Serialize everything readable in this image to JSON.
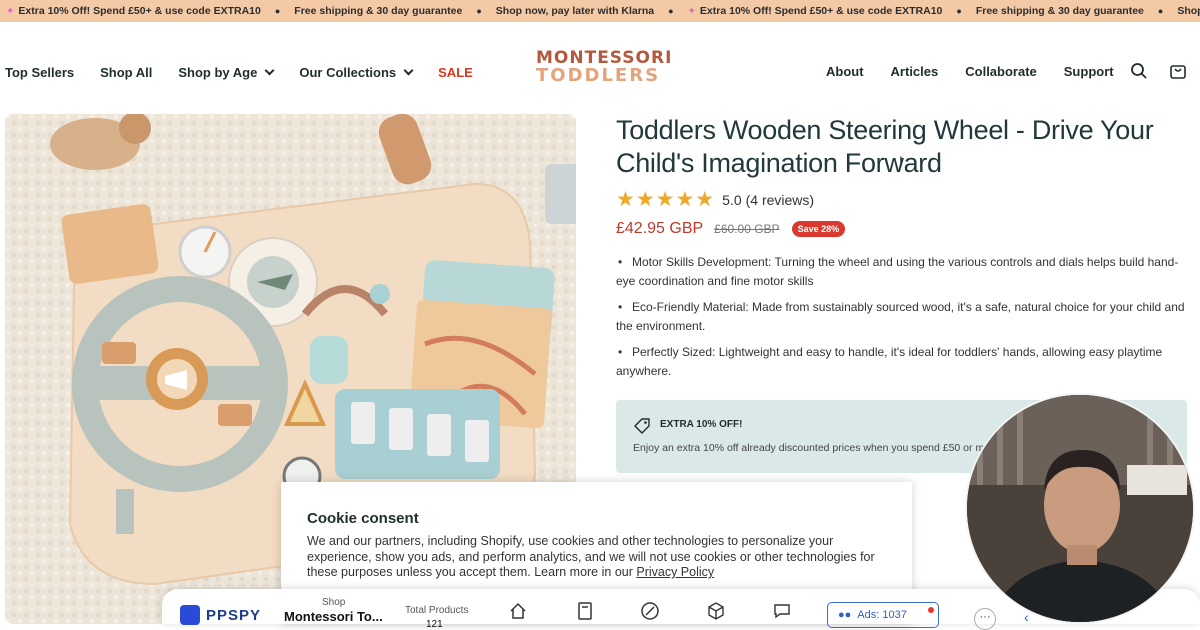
{
  "announcement": {
    "items": [
      {
        "icon": "sparkle-icon",
        "text": "Extra 10% Off! Spend £50+ & use code EXTRA10"
      },
      {
        "icon": "",
        "text": "Free shipping & 30 day guarantee"
      },
      {
        "icon": "",
        "text": "Shop now, pay later with Klarna"
      },
      {
        "icon": "sparkle-icon",
        "text": "Extra 10% Off! Spend £50+ & use code EXTRA10"
      },
      {
        "icon": "",
        "text": "Free shipping & 30 day guarantee"
      },
      {
        "icon": "",
        "text": "Shop now, pay later with Klarna"
      }
    ]
  },
  "nav": {
    "top_sellers": "Top Sellers",
    "shop_all": "Shop All",
    "shop_by_age": "Shop by Age",
    "our_collections": "Our Collections",
    "sale": "SALE",
    "about": "About",
    "articles": "Articles",
    "collaborate": "Collaborate",
    "support": "Support"
  },
  "logo": {
    "line1": "MONTESSORI",
    "line2": "TODDLERS"
  },
  "product": {
    "title": "Toddlers Wooden Steering Wheel - Drive Your Child's Imagination Forward",
    "stars": "★★★★★",
    "rating": "5.0",
    "reviews": "(4 reviews)",
    "price": "£42.95 GBP",
    "old_price": "£60.00 GBP",
    "save_badge": "Save 28%",
    "bullets": [
      {
        "head": "Motor Skills Development:",
        "text": " Turning the wheel and using the various controls and dials helps build hand-eye coordination and fine motor skills"
      },
      {
        "head": "Eco-Friendly Material:",
        "text": " Made from sustainably sourced wood, it's a safe, natural choice for your child and the environment."
      },
      {
        "head": "Perfectly Sized:",
        "text": " Lightweight and easy to handle, it's ideal for toddlers' hands, allowing easy playtime anywhere."
      }
    ]
  },
  "promo": {
    "heading": "EXTRA 10% OFF!",
    "text": "Enjoy an extra 10% off already discounted prices when you spend £50 or m"
  },
  "cookie": {
    "title": "Cookie consent",
    "text": "We and our partners, including Shopify, use cookies and other technologies to personalize your experience, show you ads, and perform analytics, and we will not use cookies or other technologies for these purposes unless you accept them. Learn more in our ",
    "link": "Privacy Policy"
  },
  "ppspy": {
    "brand": "PPSPY",
    "shop_label": "Shop",
    "shop_name": "Montessori To...",
    "total_products_label": "Total Products",
    "total_products_value": "121",
    "ads_label": "Ads: 1037",
    "more": "···"
  },
  "colors": {
    "announcement_bg": "#f4c9a6",
    "accent_red": "#d33a1f",
    "title_text": "#22383a",
    "promo_bg": "#dbe8e8",
    "ppspy_blue": "#2a4bd6"
  }
}
